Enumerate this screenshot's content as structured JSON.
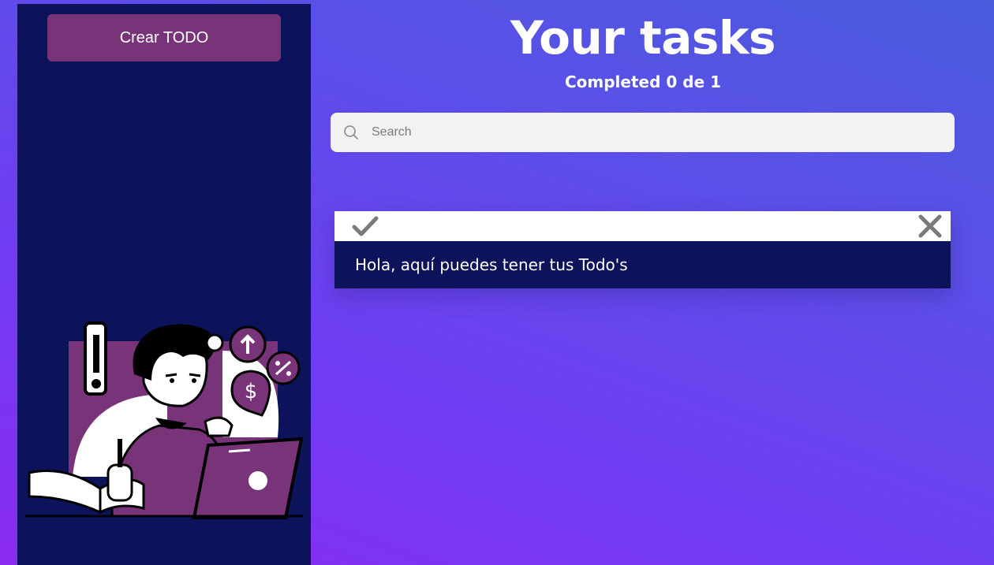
{
  "sidebar": {
    "create_button_label": "Crear TODO",
    "illustration_icon": "person-at-laptop-illustration"
  },
  "header": {
    "title": "Your tasks",
    "subtitle": "Completed 0 de 1"
  },
  "search": {
    "placeholder": "Search",
    "value": "",
    "icon": "search-icon"
  },
  "todos": [
    {
      "text": "Hola, aquí puedes tener tus Todo's",
      "completed": false,
      "check_icon": "check-icon",
      "delete_icon": "close-icon"
    }
  ],
  "colors": {
    "sidebar_bg": "#0c135a",
    "button_bg": "#793479",
    "accent_purple": "#793479",
    "todo_body_bg": "#0c135a",
    "icon_gray": "#7a7a7a"
  }
}
